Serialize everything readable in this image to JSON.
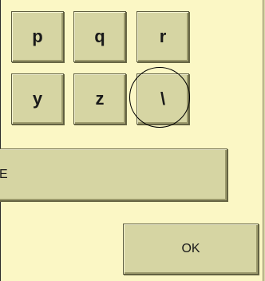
{
  "keyboard": {
    "row1": [
      {
        "label": "p"
      },
      {
        "label": "q"
      },
      {
        "label": "r"
      }
    ],
    "row2": [
      {
        "label": "y"
      },
      {
        "label": "z"
      },
      {
        "label": "\\"
      }
    ],
    "wide_key": {
      "label": "E"
    },
    "ok_button": {
      "label": "OK"
    }
  },
  "colors": {
    "background": "#fbf7c5",
    "key": "#d6d5a3"
  }
}
